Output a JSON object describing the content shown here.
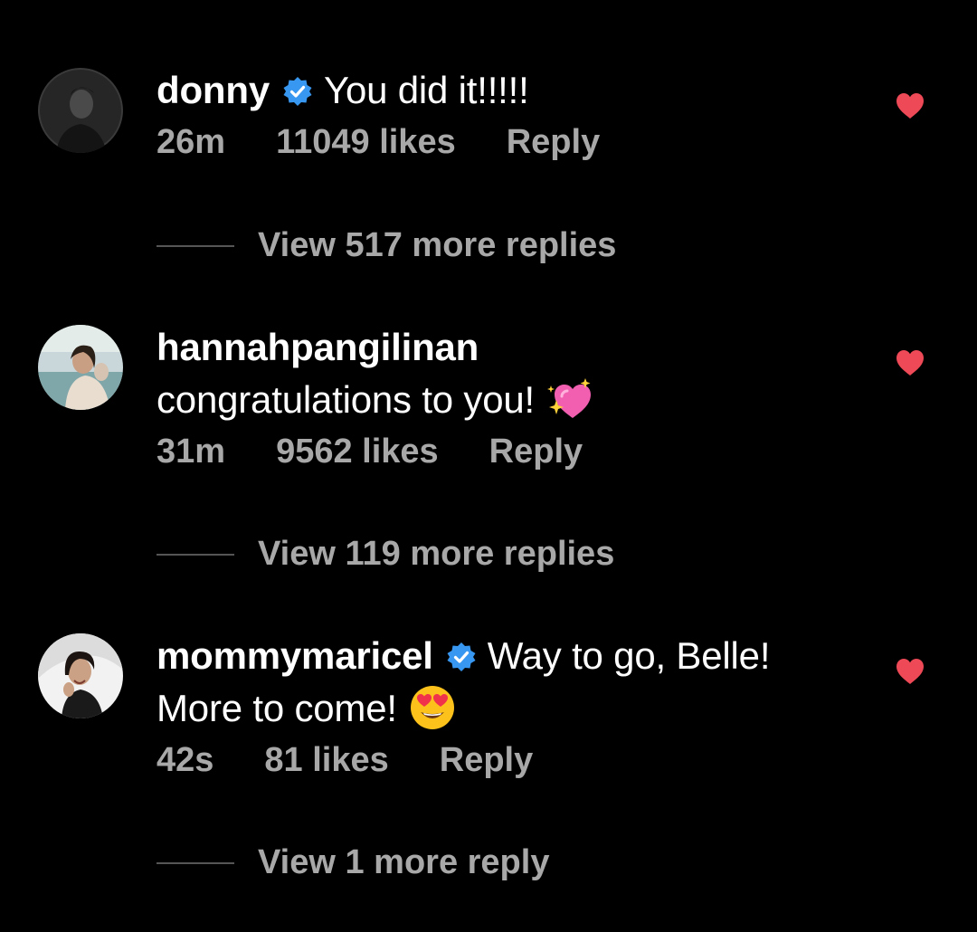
{
  "colors": {
    "background": "#000000",
    "text_primary": "#ffffff",
    "text_secondary": "#a8a8a8",
    "verified_blue": "#3897f0",
    "like_red": "#ed4956"
  },
  "comments": [
    {
      "username": "donny",
      "verified": true,
      "text": "You did it!!!!!",
      "text_line2": "",
      "time": "26m",
      "likes": "11049 likes",
      "reply_label": "Reply",
      "view_replies": "View 517 more replies",
      "liked": true,
      "emoji_icon": ""
    },
    {
      "username": "hannahpangilinan",
      "verified": false,
      "text": "",
      "text_line2": "congratulations to you!",
      "time": "31m",
      "likes": "9562 likes",
      "reply_label": "Reply",
      "view_replies": "View 119 more replies",
      "liked": true,
      "emoji_icon": "sparkling-heart-icon"
    },
    {
      "username": "mommymaricel",
      "verified": true,
      "text": "Way to go, Belle!",
      "text_line2": "More to come!",
      "time": "42s",
      "likes": "81 likes",
      "reply_label": "Reply",
      "view_replies": "View 1 more reply",
      "liked": true,
      "emoji_icon": "heart-eyes-face-icon"
    }
  ]
}
